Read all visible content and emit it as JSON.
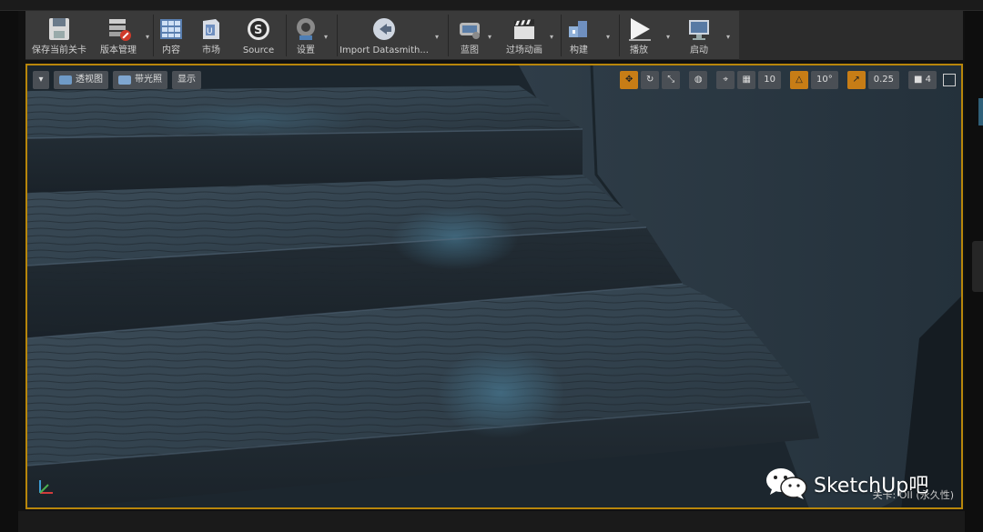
{
  "toolbar": {
    "save": "保存当前关卡",
    "source_control": "版本管理",
    "content": "内容",
    "marketplace": "市场",
    "source": "Source",
    "settings": "设置",
    "datasmith": "Import Datasmith...",
    "blueprints": "蓝图",
    "cinematics": "过场动画",
    "build": "构建",
    "play": "播放",
    "launch": "启动",
    "dropdown_glyph": "▾"
  },
  "viewport": {
    "menu_glyph": "▾",
    "perspective": "透视图",
    "lit": "带光照",
    "show": "显示",
    "grid_snap_value": "10",
    "rotation_snap_value": "10°",
    "scale_snap_value": "0.25",
    "camera_speed_value": "4",
    "level_status": "关卡: OII (永久性)"
  },
  "colors": {
    "accent": "#c77d16",
    "viewport_border": "#b8860b",
    "toolbar_bg": "#3a3a3a"
  },
  "watermark": {
    "text": "SketchUp吧"
  }
}
